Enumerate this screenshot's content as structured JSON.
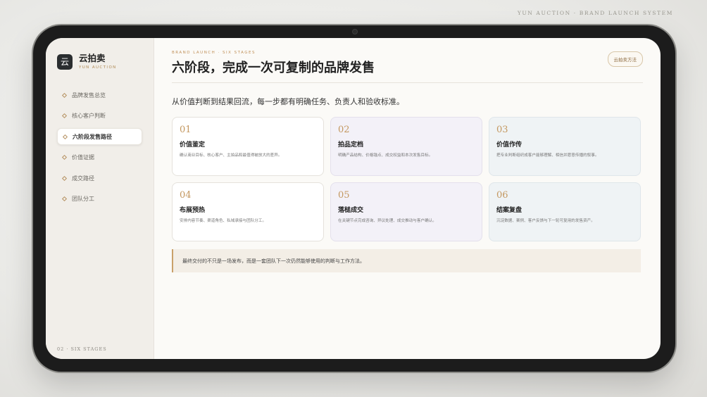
{
  "top_caption": "YUN AUCTION · BRAND LAUNCH SYSTEM",
  "brand": {
    "logo_char": "云",
    "name": "云拍卖",
    "sub": "YUN AUCTION"
  },
  "nav": {
    "items": [
      {
        "label": "品牌发售总览"
      },
      {
        "label": "核心客户判断"
      },
      {
        "label": "六阶段发售路径",
        "active": true
      },
      {
        "label": "价值证据"
      },
      {
        "label": "成交路径"
      },
      {
        "label": "团队分工"
      }
    ]
  },
  "footer_caption": "02 · SIX STAGES",
  "header": {
    "eyebrow": "BRAND LAUNCH · SIX STAGES",
    "title": "六阶段，完成一次可复制的品牌发售",
    "method_button": "云拍卖方法"
  },
  "subtitle": "从价值判断到结果回流，每一步都有明确任务、负责人和验收标准。",
  "stages": [
    {
      "num": "01",
      "title": "价值鉴定",
      "desc": "确认商业目标、核心客户、主拍品和最值得被放大的差异。"
    },
    {
      "num": "02",
      "title": "拍品定档",
      "desc": "明确产品结构、价格锚点、成交权益和本次发售目标。"
    },
    {
      "num": "03",
      "title": "价值作传",
      "desc": "把专业判断组织成客户能够理解、相信并愿意传播的叙事。"
    },
    {
      "num": "04",
      "title": "布展预热",
      "desc": "安排内容节奏、渠道角色、私域承接与团队分工。"
    },
    {
      "num": "05",
      "title": "落槌成交",
      "desc": "在关键节点完成咨询、异议处理、成交推动与客户确认。"
    },
    {
      "num": "06",
      "title": "结案复盘",
      "desc": "沉淀数据、案例、客户反馈与下一轮可复用的发售资产。"
    }
  ],
  "note": "最终交付的不只是一场发布，而是一套团队下一次仍然能够使用的判断与工作方法。"
}
